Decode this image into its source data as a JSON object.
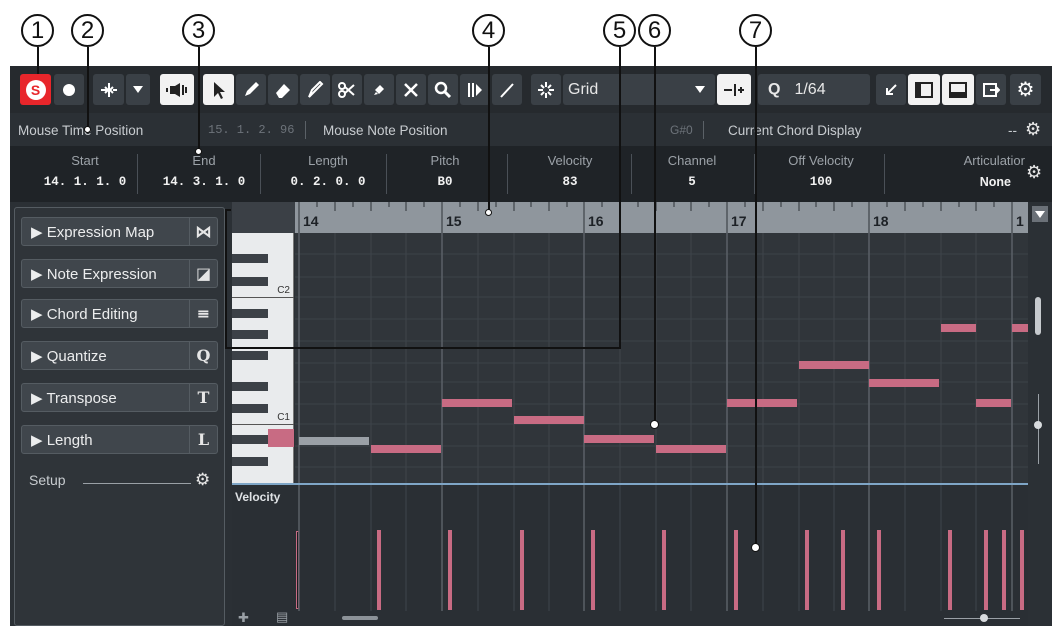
{
  "callouts": [
    "1",
    "2",
    "3",
    "4",
    "5",
    "6",
    "7"
  ],
  "toolbar": {
    "solo_label": "S",
    "grid_label": "Grid",
    "quantize_prefix": "Q",
    "quantize_value": "1/64"
  },
  "infoline": {
    "mouse_time_label": "Mouse Time Position",
    "mouse_time_value": "15. 1. 2. 96",
    "mouse_note_label": "Mouse Note Position",
    "mouse_note_value": "G#0",
    "chord_label": "Current Chord Display",
    "chord_value": "--"
  },
  "event_info": {
    "columns": [
      {
        "header": "Start",
        "value": "14. 1. 1. 0"
      },
      {
        "header": "End",
        "value": "14. 3. 1. 0"
      },
      {
        "header": "Length",
        "value": "0. 2. 0. 0"
      },
      {
        "header": "Pitch",
        "value": "B0"
      },
      {
        "header": "Velocity",
        "value": "83"
      },
      {
        "header": "Channel",
        "value": "5"
      },
      {
        "header": "Off Velocity",
        "value": "100"
      },
      {
        "header": "Articulatior",
        "value": "None"
      }
    ]
  },
  "left_zone": {
    "sections": [
      {
        "label": "Expression Map",
        "icon": "expression-map-icon"
      },
      {
        "label": "Note Expression",
        "icon": "note-expression-icon"
      },
      {
        "label": "Chord Editing",
        "icon": "chord-editing-icon"
      },
      {
        "label": "Quantize",
        "icon_text": "Q"
      },
      {
        "label": "Transpose",
        "icon_text": "T"
      },
      {
        "label": "Length",
        "icon_text": "L"
      }
    ],
    "setup_label": "Setup"
  },
  "keyboard": {
    "labels": [
      "C2",
      "C1"
    ]
  },
  "ruler": {
    "bars": [
      "14",
      "15",
      "16",
      "17",
      "18",
      "1"
    ]
  },
  "velocity_label": "Velocity",
  "colors": {
    "accent_red": "#e8262b",
    "note": "#c86b83",
    "ruler": "#8f969d"
  }
}
